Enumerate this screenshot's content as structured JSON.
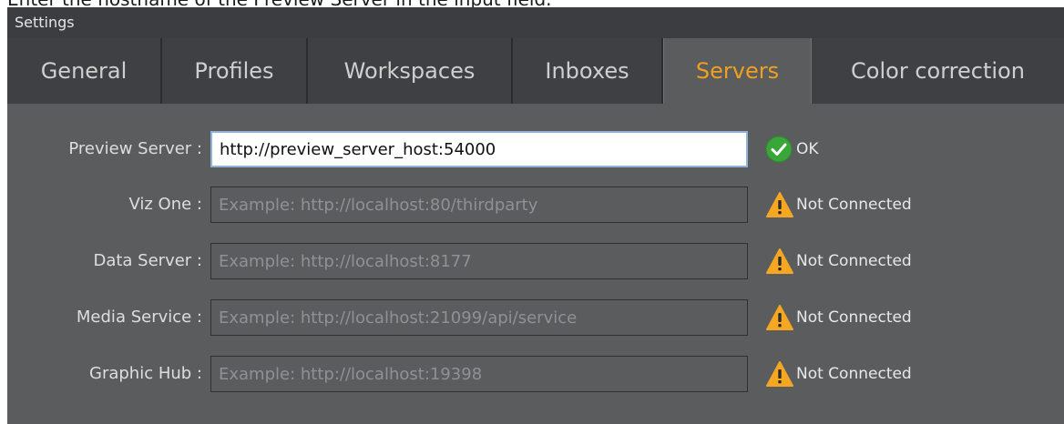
{
  "caption": "Enter the hostname of the Preview Server in the input field.",
  "window": {
    "title": "Settings"
  },
  "tabs": [
    {
      "label": "General"
    },
    {
      "label": "Profiles"
    },
    {
      "label": "Workspaces"
    },
    {
      "label": "Inboxes"
    },
    {
      "label": "Servers",
      "active": true
    },
    {
      "label": "Color correction"
    }
  ],
  "servers": [
    {
      "label": "Preview Server :",
      "value": "http://preview_server_host:54000",
      "placeholder": "",
      "status": "OK",
      "status_icon": "check-circle-icon"
    },
    {
      "label": "Viz One :",
      "value": "",
      "placeholder": "Example: http://localhost:80/thirdparty",
      "status": "Not Connected",
      "status_icon": "warning-icon"
    },
    {
      "label": "Data Server :",
      "value": "",
      "placeholder": "Example: http://localhost:8177",
      "status": "Not Connected",
      "status_icon": "warning-icon"
    },
    {
      "label": "Media Service :",
      "value": "",
      "placeholder": "Example: http://localhost:21099/api/service",
      "status": "Not Connected",
      "status_icon": "warning-icon"
    },
    {
      "label": "Graphic Hub :",
      "value": "",
      "placeholder": "Example: http://localhost:19398",
      "status": "Not Connected",
      "status_icon": "warning-icon"
    }
  ],
  "colors": {
    "active_tab": "#f0a020",
    "ok": "#3aa63a",
    "warning": "#f5a623",
    "panel": "#5a5c5e"
  }
}
